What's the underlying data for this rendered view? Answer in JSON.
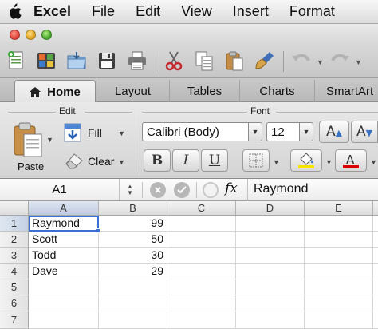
{
  "menubar": {
    "app": "Excel",
    "items": [
      "File",
      "Edit",
      "View",
      "Insert",
      "Format"
    ]
  },
  "ribbon_tabs": [
    "Home",
    "Layout",
    "Tables",
    "Charts",
    "SmartArt"
  ],
  "ribbon": {
    "edit_group": "Edit",
    "font_group": "Font",
    "paste_label": "Paste",
    "fill_label": "Fill",
    "clear_label": "Clear",
    "font_name": "Calibri (Body)",
    "font_size": "12",
    "bold": "B",
    "italic": "I",
    "underline": "U"
  },
  "formula_bar": {
    "name_box": "A1",
    "fx": "fx",
    "value": "Raymond"
  },
  "sheet": {
    "columns": [
      "A",
      "B",
      "C",
      "D",
      "E"
    ],
    "rows": [
      "1",
      "2",
      "3",
      "4",
      "5",
      "6",
      "7"
    ],
    "cells": [
      [
        "Raymond",
        "99"
      ],
      [
        "Scott",
        "50"
      ],
      [
        "Todd",
        "30"
      ],
      [
        "Dave",
        "29"
      ]
    ],
    "active_cell": "A1"
  },
  "colors": {
    "selection": "#3c6fd3",
    "fill_highlight": "#f7e500",
    "font_color": "#d80000"
  }
}
